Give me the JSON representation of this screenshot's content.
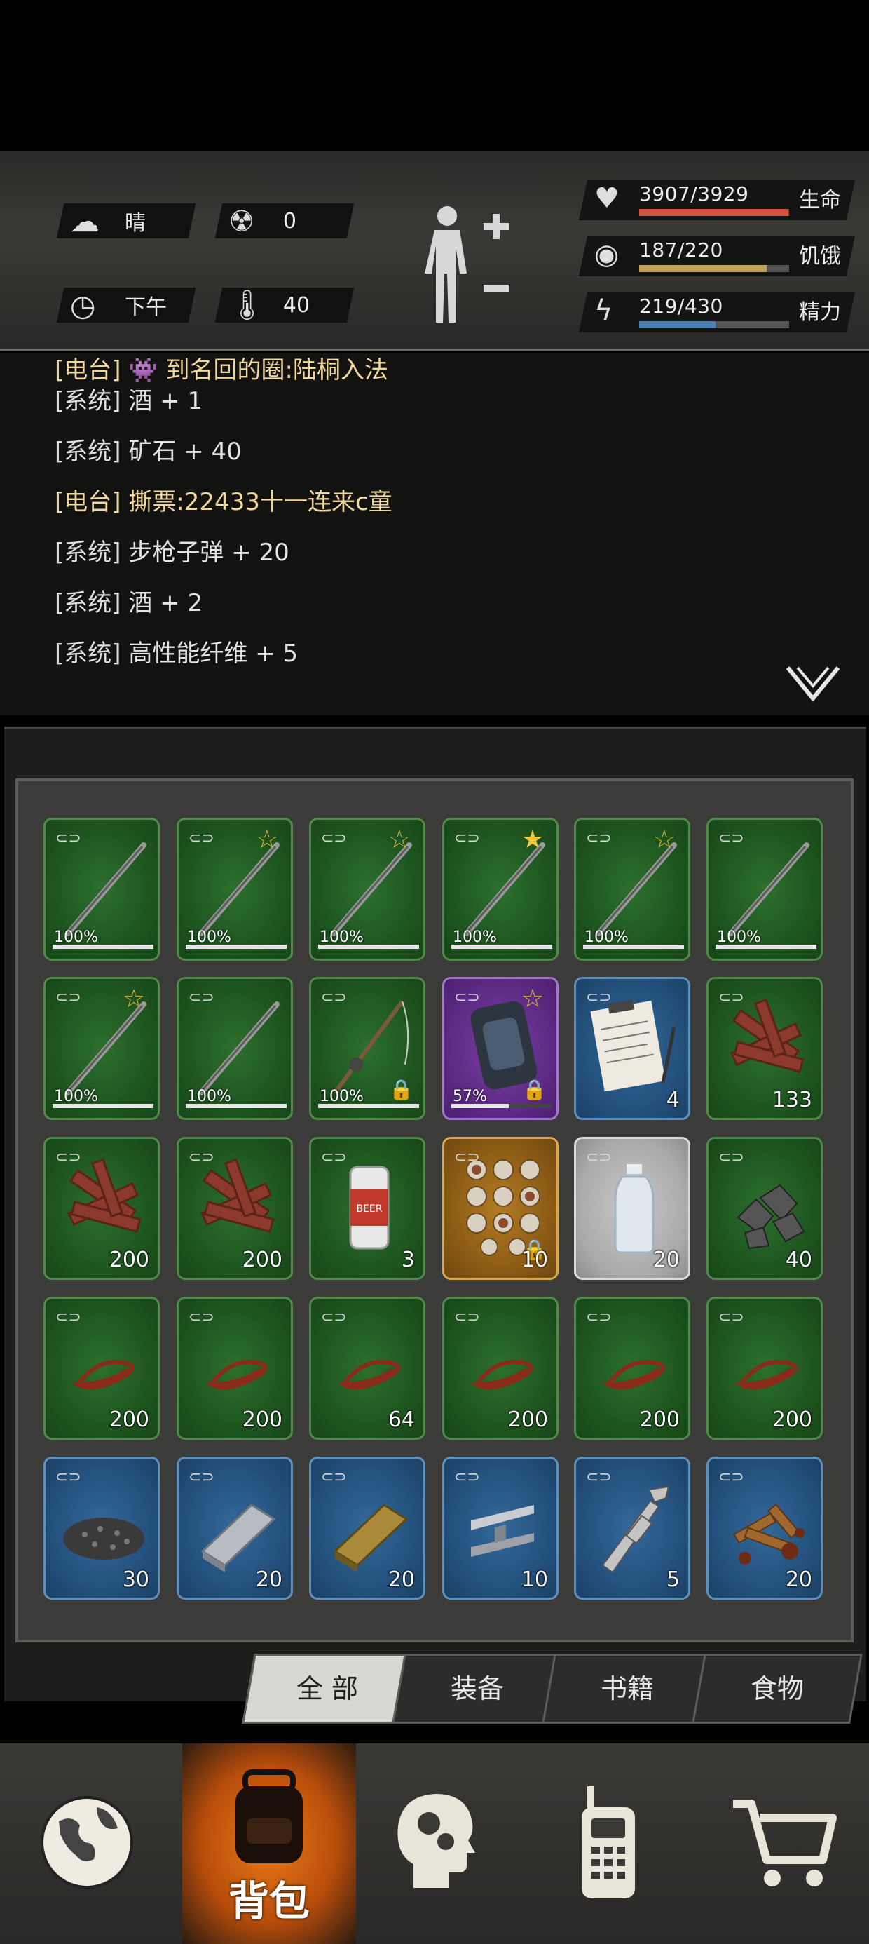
{
  "status": {
    "weather": {
      "icon": "cloud-sun-icon",
      "label": "晴"
    },
    "radiation": {
      "icon": "radiation-icon",
      "value": "0"
    },
    "time": {
      "icon": "clock-icon",
      "label": "下午"
    },
    "temperature": {
      "icon": "thermometer-icon",
      "value": "40"
    },
    "stats": [
      {
        "key": "health",
        "icon": "heart-pulse-icon",
        "value": "3907/3929",
        "label": "生命",
        "fraction": 0.9944,
        "color": "#d2553d"
      },
      {
        "key": "hunger",
        "icon": "stomach-icon",
        "value": "187/220",
        "label": "饥饿",
        "fraction": 0.85,
        "color": "#c2a15a"
      },
      {
        "key": "energy",
        "icon": "energy-head-icon",
        "value": "219/430",
        "label": "精力",
        "fraction": 0.509,
        "color": "#4b7fb5"
      }
    ]
  },
  "log": {
    "partial_top": "[电台] 👾 到名回的圈:陆桐入法",
    "lines": [
      {
        "tag": "[系统]",
        "msg": "酒 + 1",
        "type": "system"
      },
      {
        "tag": "[系统]",
        "msg": "矿石 + 40",
        "type": "system"
      },
      {
        "tag": "[电台]",
        "msg": "撕票:22433十一连来c童",
        "type": "radio"
      },
      {
        "tag": "[系统]",
        "msg": "步枪子弹 + 20",
        "type": "system"
      },
      {
        "tag": "[系统]",
        "msg": "酒 + 2",
        "type": "system"
      },
      {
        "tag": "[系统]",
        "msg": "高性能纤维 + 5",
        "type": "system"
      }
    ]
  },
  "inventory": {
    "rows": [
      [
        {
          "rarity": "green",
          "icon": "stick-icon",
          "star": "",
          "durability": "100%",
          "dur_fraction": 1,
          "qty": "",
          "locked": false
        },
        {
          "rarity": "green",
          "icon": "stick-icon",
          "star": "outline",
          "durability": "100%",
          "dur_fraction": 1,
          "qty": "",
          "locked": false
        },
        {
          "rarity": "green",
          "icon": "stick-icon",
          "star": "outline",
          "durability": "100%",
          "dur_fraction": 1,
          "qty": "",
          "locked": false
        },
        {
          "rarity": "green",
          "icon": "stick-icon",
          "star": "filled",
          "durability": "100%",
          "dur_fraction": 1,
          "qty": "",
          "locked": false
        },
        {
          "rarity": "green",
          "icon": "stick-icon",
          "star": "outline",
          "durability": "100%",
          "dur_fraction": 1,
          "qty": "",
          "locked": false
        },
        {
          "rarity": "green",
          "icon": "stick-icon",
          "star": "",
          "durability": "100%",
          "dur_fraction": 1,
          "qty": "",
          "locked": false
        }
      ],
      [
        {
          "rarity": "green",
          "icon": "stick-icon",
          "star": "outline",
          "durability": "100%",
          "dur_fraction": 1,
          "qty": "",
          "locked": false
        },
        {
          "rarity": "green",
          "icon": "stick-icon",
          "star": "",
          "durability": "100%",
          "dur_fraction": 1,
          "qty": "",
          "locked": false
        },
        {
          "rarity": "green",
          "icon": "fishing-rod-icon",
          "star": "",
          "durability": "100%",
          "dur_fraction": 1,
          "qty": "",
          "locked": true
        },
        {
          "rarity": "purple",
          "icon": "armor-vest-icon",
          "star": "outline",
          "durability": "57%",
          "dur_fraction": 0.57,
          "qty": "",
          "locked": true
        },
        {
          "rarity": "blue",
          "icon": "clipboard-icon",
          "star": "",
          "durability": "",
          "dur_fraction": 0,
          "qty": "4",
          "locked": false
        },
        {
          "rarity": "green",
          "icon": "wood-planks-icon",
          "star": "",
          "durability": "",
          "dur_fraction": 0,
          "qty": "133",
          "locked": false
        }
      ],
      [
        {
          "rarity": "green",
          "icon": "wood-planks-icon",
          "star": "",
          "durability": "",
          "dur_fraction": 0,
          "qty": "200",
          "locked": false
        },
        {
          "rarity": "green",
          "icon": "wood-planks-icon",
          "star": "",
          "durability": "",
          "dur_fraction": 0,
          "qty": "200",
          "locked": false
        },
        {
          "rarity": "green",
          "icon": "beer-can-icon",
          "star": "",
          "durability": "",
          "dur_fraction": 0,
          "qty": "3",
          "locked": false
        },
        {
          "rarity": "gold",
          "icon": "feast-icon",
          "star": "",
          "durability": "",
          "dur_fraction": 0,
          "qty": "10",
          "locked": true
        },
        {
          "rarity": "grey",
          "icon": "water-bottle-icon",
          "star": "",
          "durability": "",
          "dur_fraction": 0,
          "qty": "20",
          "locked": false
        },
        {
          "rarity": "green",
          "icon": "ore-icon",
          "star": "",
          "durability": "",
          "dur_fraction": 0,
          "qty": "40",
          "locked": false
        }
      ],
      [
        {
          "rarity": "green",
          "icon": "worm-icon",
          "star": "",
          "durability": "",
          "dur_fraction": 0,
          "qty": "200",
          "locked": false
        },
        {
          "rarity": "green",
          "icon": "worm-icon",
          "star": "",
          "durability": "",
          "dur_fraction": 0,
          "qty": "200",
          "locked": false
        },
        {
          "rarity": "green",
          "icon": "worm-icon",
          "star": "",
          "durability": "",
          "dur_fraction": 0,
          "qty": "64",
          "locked": false
        },
        {
          "rarity": "green",
          "icon": "worm-icon",
          "star": "",
          "durability": "",
          "dur_fraction": 0,
          "qty": "200",
          "locked": false
        },
        {
          "rarity": "green",
          "icon": "worm-icon",
          "star": "",
          "durability": "",
          "dur_fraction": 0,
          "qty": "200",
          "locked": false
        },
        {
          "rarity": "green",
          "icon": "worm-icon",
          "star": "",
          "durability": "",
          "dur_fraction": 0,
          "qty": "200",
          "locked": false
        }
      ],
      [
        {
          "rarity": "blue",
          "icon": "gravel-icon",
          "star": "",
          "durability": "",
          "dur_fraction": 0,
          "qty": "30",
          "locked": false
        },
        {
          "rarity": "blue",
          "icon": "steel-ingot-icon",
          "star": "",
          "durability": "",
          "dur_fraction": 0,
          "qty": "20",
          "locked": false
        },
        {
          "rarity": "blue",
          "icon": "gold-ingot-icon",
          "star": "",
          "durability": "",
          "dur_fraction": 0,
          "qty": "20",
          "locked": false
        },
        {
          "rarity": "blue",
          "icon": "steel-beam-icon",
          "star": "",
          "durability": "",
          "dur_fraction": 0,
          "qty": "10",
          "locked": false
        },
        {
          "rarity": "blue",
          "icon": "rifle-part-icon",
          "star": "",
          "durability": "",
          "dur_fraction": 0,
          "qty": "5",
          "locked": false
        },
        {
          "rarity": "blue",
          "icon": "spices-icon",
          "star": "",
          "durability": "",
          "dur_fraction": 0,
          "qty": "20",
          "locked": false
        }
      ]
    ]
  },
  "filters": [
    {
      "label": "全 部",
      "active": true
    },
    {
      "label": "装备",
      "active": false
    },
    {
      "label": "书籍",
      "active": false
    },
    {
      "label": "食物",
      "active": false
    }
  ],
  "nav": [
    {
      "key": "world",
      "icon": "globe-icon",
      "label": "",
      "active": false
    },
    {
      "key": "backpack",
      "icon": "backpack-icon",
      "label": "背包",
      "active": true
    },
    {
      "key": "skills",
      "icon": "head-gears-icon",
      "label": "",
      "active": false
    },
    {
      "key": "radio",
      "icon": "walkie-talkie-icon",
      "label": "",
      "active": false
    },
    {
      "key": "shop",
      "icon": "cart-icon",
      "label": "",
      "active": false
    }
  ]
}
